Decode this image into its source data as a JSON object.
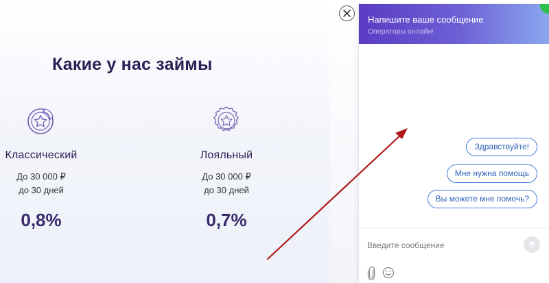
{
  "page": {
    "title": "Какие у нас займы",
    "cards": [
      {
        "name": "Классический",
        "amount": "До 30 000 ₽",
        "term": "до 30 дней",
        "rate": "0,8%"
      },
      {
        "name": "Лояльный",
        "amount": "До 30 000 ₽",
        "term": "до 30 дней",
        "rate": "0,7%"
      }
    ]
  },
  "chat": {
    "title": "Напишите ваше сообщение",
    "subtitle": "Операторы онлайн!",
    "quick_replies": [
      "Здравствуйте!",
      "Мне нужна помощь",
      "Вы можете мне помочь?"
    ],
    "input_placeholder": "Введите сообщение",
    "status_color": "#2ec04f",
    "accent_color": "#3b78d8"
  },
  "annotation": {
    "arrow_color": "#b01818"
  },
  "icons": {
    "close": "close-icon",
    "send": "arrow-up-icon",
    "attach": "paperclip-icon",
    "emoji": "smiley-icon",
    "classic_badge": "star-sticker-icon",
    "loyal_badge": "star-seal-icon"
  }
}
